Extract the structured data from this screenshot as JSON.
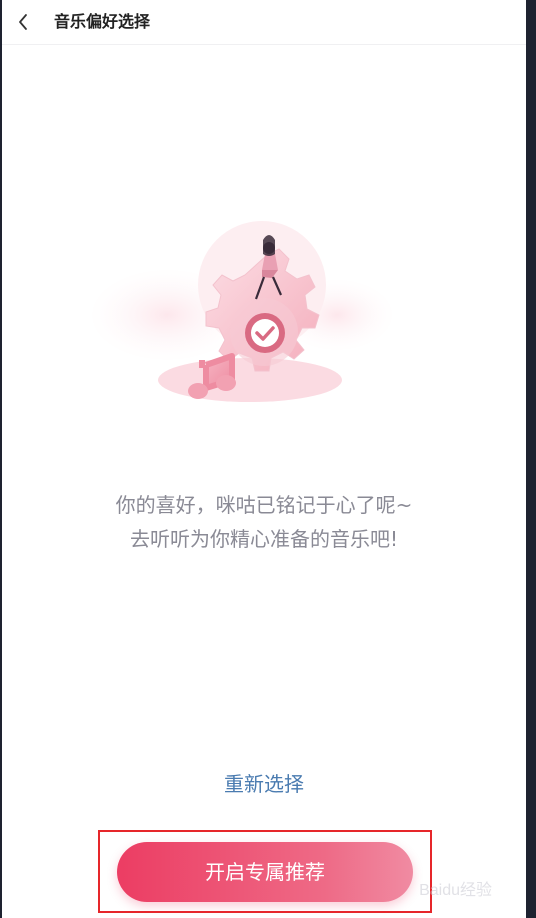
{
  "header": {
    "title": "音乐偏好选择",
    "back_icon": "chevron-left-icon"
  },
  "illustration": {
    "icons": [
      "gear-icon",
      "check-icon",
      "music-note-icon",
      "girl-figure"
    ]
  },
  "message": {
    "line1": "你的喜好，咪咕已铭记于心了呢~",
    "line2": "去听听为你精心准备的音乐吧!"
  },
  "actions": {
    "reselect_label": "重新选择",
    "primary_label": "开启专属推荐"
  },
  "watermark": {
    "text": "Baidu经验"
  },
  "colors": {
    "accent_pink": "#ec3d63",
    "link_blue": "#4a7bb0",
    "highlight_red": "#e6262a",
    "message_gray": "#8a8a95"
  }
}
